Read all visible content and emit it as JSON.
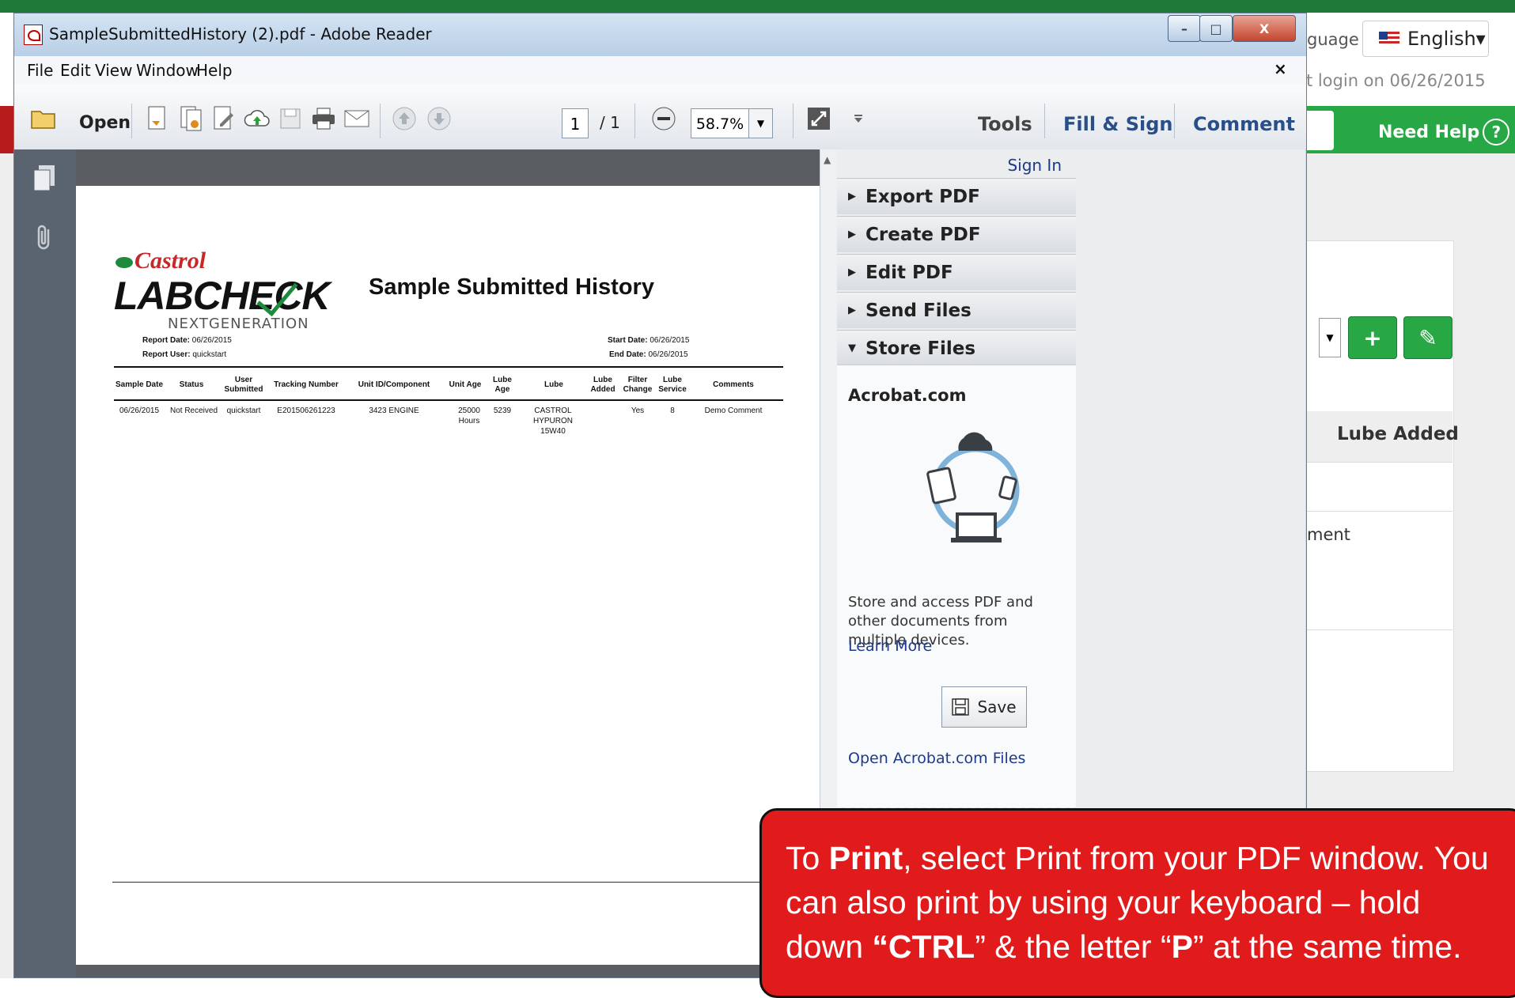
{
  "background_page": {
    "language_label": "guage",
    "language_value": "English▾",
    "last_login": "st login on 06/26/2015",
    "need_help": "Need Help",
    "help_icon": "?",
    "add_icon": "+",
    "edit_icon": "✎",
    "lube_added_header": "Lube Added",
    "comment_fragment": "ment"
  },
  "window": {
    "title": "SampleSubmittedHistory (2).pdf - Adobe Reader",
    "min_glyph": "–",
    "max_glyph": "□",
    "close_glyph": "X",
    "menu_close": "×"
  },
  "menu": {
    "items": [
      "File",
      "Edit",
      "View",
      "Window",
      "Help"
    ]
  },
  "toolbar": {
    "open_label": "Open",
    "page_current": "1",
    "page_total": "/ 1",
    "zoom": "58.7%",
    "tools": "Tools",
    "fill_sign": "Fill & Sign",
    "comment": "Comment"
  },
  "document": {
    "logo_brand": "Castrol",
    "logo_product": "LABCHECK",
    "logo_tagline": "NEXTGENERATION",
    "title": "Sample Submitted History",
    "report_date_label": "Report Date:",
    "report_date": "06/26/2015",
    "report_user_label": "Report User:",
    "report_user": "quickstart",
    "start_date_label": "Start Date:",
    "start_date": "06/26/2015",
    "end_date_label": "End Date:",
    "end_date": "06/26/2015",
    "columns": [
      "Sample Date",
      "Status",
      "User Submitted",
      "Tracking Number",
      "Unit ID/Component",
      "Unit Age",
      "Lube Age",
      "Lube",
      "Lube Added",
      "Filter Change",
      "Lube Service",
      "Comments"
    ],
    "rows": [
      [
        "06/26/2015",
        "Not Received",
        "quickstart",
        "E201506261223",
        "3423 ENGINE",
        "25000 Hours",
        "5239",
        "CASTROL HYPURON 15W40",
        "",
        "Yes",
        "8",
        "Demo Comment"
      ]
    ]
  },
  "panel": {
    "sign_in": "Sign In",
    "sections": [
      "Export PDF",
      "Create PDF",
      "Edit PDF",
      "Send Files",
      "Store Files"
    ],
    "acrobat_label": "Acrobat.com",
    "store_desc": "Store and access PDF and other documents from multiple devices.",
    "learn_more": "Learn More",
    "save": "Save",
    "open_files": "Open Acrobat.com Files"
  },
  "callout": {
    "t1": "To ",
    "b1": "Print",
    "t2": ", select Print from your PDF window. You can also print by using your keyboard – hold down ",
    "b2": "“CTRL",
    "t3": "” & the letter “",
    "b3": "P",
    "t4": "” at the same time."
  },
  "colors": {
    "accent_green": "#28a745",
    "callout_red": "#e11b1b",
    "link_blue": "#1d3a8a"
  }
}
